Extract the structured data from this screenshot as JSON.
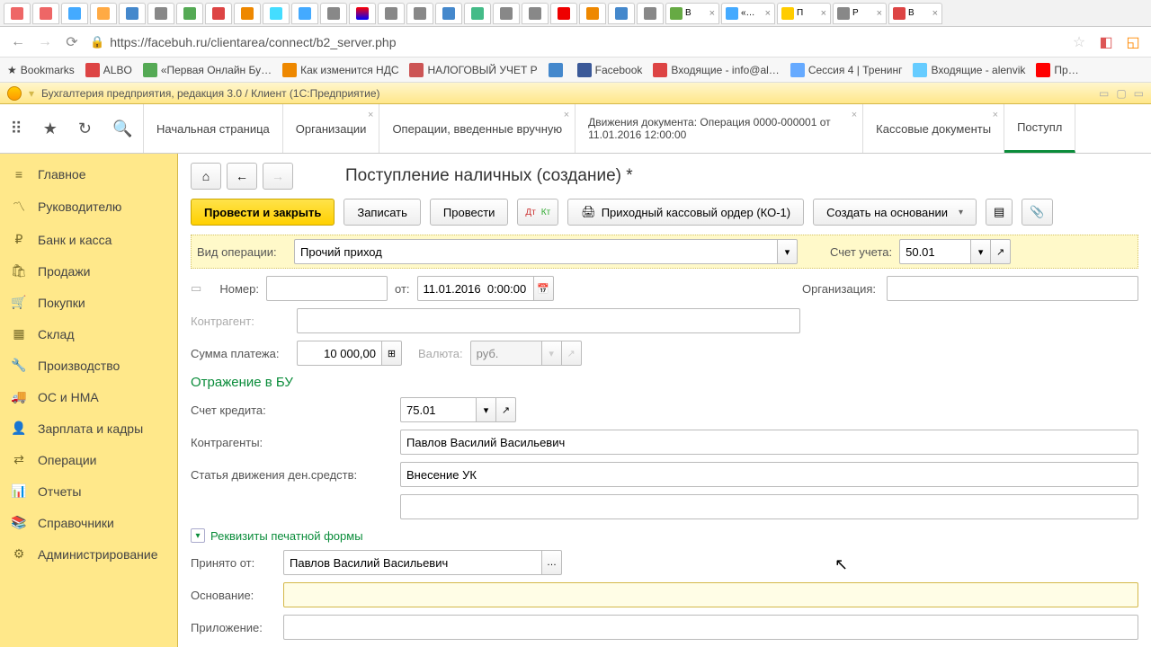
{
  "browser": {
    "url": "https://facebuh.ru/clientarea/connect/b2_server.php",
    "bookmarks_label": "Bookmarks",
    "bookmarks": [
      {
        "label": "ALBO",
        "color": "#d44"
      },
      {
        "label": "«Первая Онлайн Бу…",
        "color": "#5a5"
      },
      {
        "label": "Как изменится НДС",
        "color": "#e80"
      },
      {
        "label": "НАЛОГОВЫЙ УЧЕТ Р",
        "color": "#c55"
      },
      {
        "label": "",
        "color": "#48c"
      },
      {
        "label": "Facebook",
        "color": "#3b5998"
      },
      {
        "label": "Входящие - info@al…",
        "color": "#d44"
      },
      {
        "label": "Сессия 4 | Тренинг",
        "color": "#6af"
      },
      {
        "label": "Входящие - alenvik",
        "color": "#6cf"
      },
      {
        "label": "Пр…",
        "color": "#f00"
      }
    ],
    "tabs_text": [
      {
        "t": "В",
        "x": true
      },
      {
        "t": "«…",
        "x": true
      },
      {
        "t": "П",
        "x": true,
        "active": true
      },
      {
        "t": "Р",
        "x": true
      },
      {
        "t": "В",
        "x": true
      }
    ]
  },
  "app": {
    "title": "Бухгалтерия предприятия, редакция 3.0 / Клиент   (1С:Предприятие)",
    "top_tabs": [
      {
        "label": "Начальная страница"
      },
      {
        "label": "Организации"
      },
      {
        "label": "Операции, введенные вручную"
      },
      {
        "label": "Движения документа: Операция 0000-000001 от 11.01.2016 12:00:00"
      },
      {
        "label": "Кассовые документы"
      },
      {
        "label": "Поступл",
        "active": true
      }
    ],
    "sidebar": [
      {
        "icon": "≡",
        "label": "Главное"
      },
      {
        "icon": "〽",
        "label": "Руководителю"
      },
      {
        "icon": "₽",
        "label": "Банк и касса"
      },
      {
        "icon": "🛍",
        "label": "Продажи"
      },
      {
        "icon": "🛒",
        "label": "Покупки"
      },
      {
        "icon": "▦",
        "label": "Склад"
      },
      {
        "icon": "🔧",
        "label": "Производство"
      },
      {
        "icon": "🚚",
        "label": "ОС и НМА"
      },
      {
        "icon": "👤",
        "label": "Зарплата и кадры"
      },
      {
        "icon": "⇄",
        "label": "Операции"
      },
      {
        "icon": "📊",
        "label": "Отчеты"
      },
      {
        "icon": "📚",
        "label": "Справочники"
      },
      {
        "icon": "⚙",
        "label": "Администрирование"
      }
    ]
  },
  "doc": {
    "title": "Поступление наличных (создание) *",
    "btn_post_close": "Провести и закрыть",
    "btn_save": "Записать",
    "btn_post": "Провести",
    "btn_order": "Приходный кассовый ордер (КО-1)",
    "btn_create": "Создать на основании",
    "lbl_op_type": "Вид операции:",
    "op_type": "Прочий приход",
    "lbl_account": "Счет учета:",
    "account": "50.01",
    "lbl_number": "Номер:",
    "number": "",
    "lbl_from": "от:",
    "date": "11.01.2016  0:00:00",
    "lbl_org": "Организация:",
    "org": "",
    "lbl_counterparty": "Контрагент:",
    "counterparty": "",
    "lbl_sum": "Сумма платежа:",
    "sum": "10 000,00",
    "lbl_currency": "Валюта:",
    "currency": "руб.",
    "section_bu": "Отражение в БУ",
    "lbl_credit": "Счет кредита:",
    "credit": "75.01",
    "lbl_counterparties": "Контрагенты:",
    "counterparties": "Павлов Василий Васильевич",
    "lbl_dds": "Статья движения ден.средств:",
    "dds": "Внесение УК",
    "section_print": "Реквизиты печатной формы",
    "lbl_received": "Принято от:",
    "received": "Павлов Василий Васильевич",
    "lbl_basis": "Основание:",
    "basis": "",
    "lbl_attach": "Приложение:"
  }
}
